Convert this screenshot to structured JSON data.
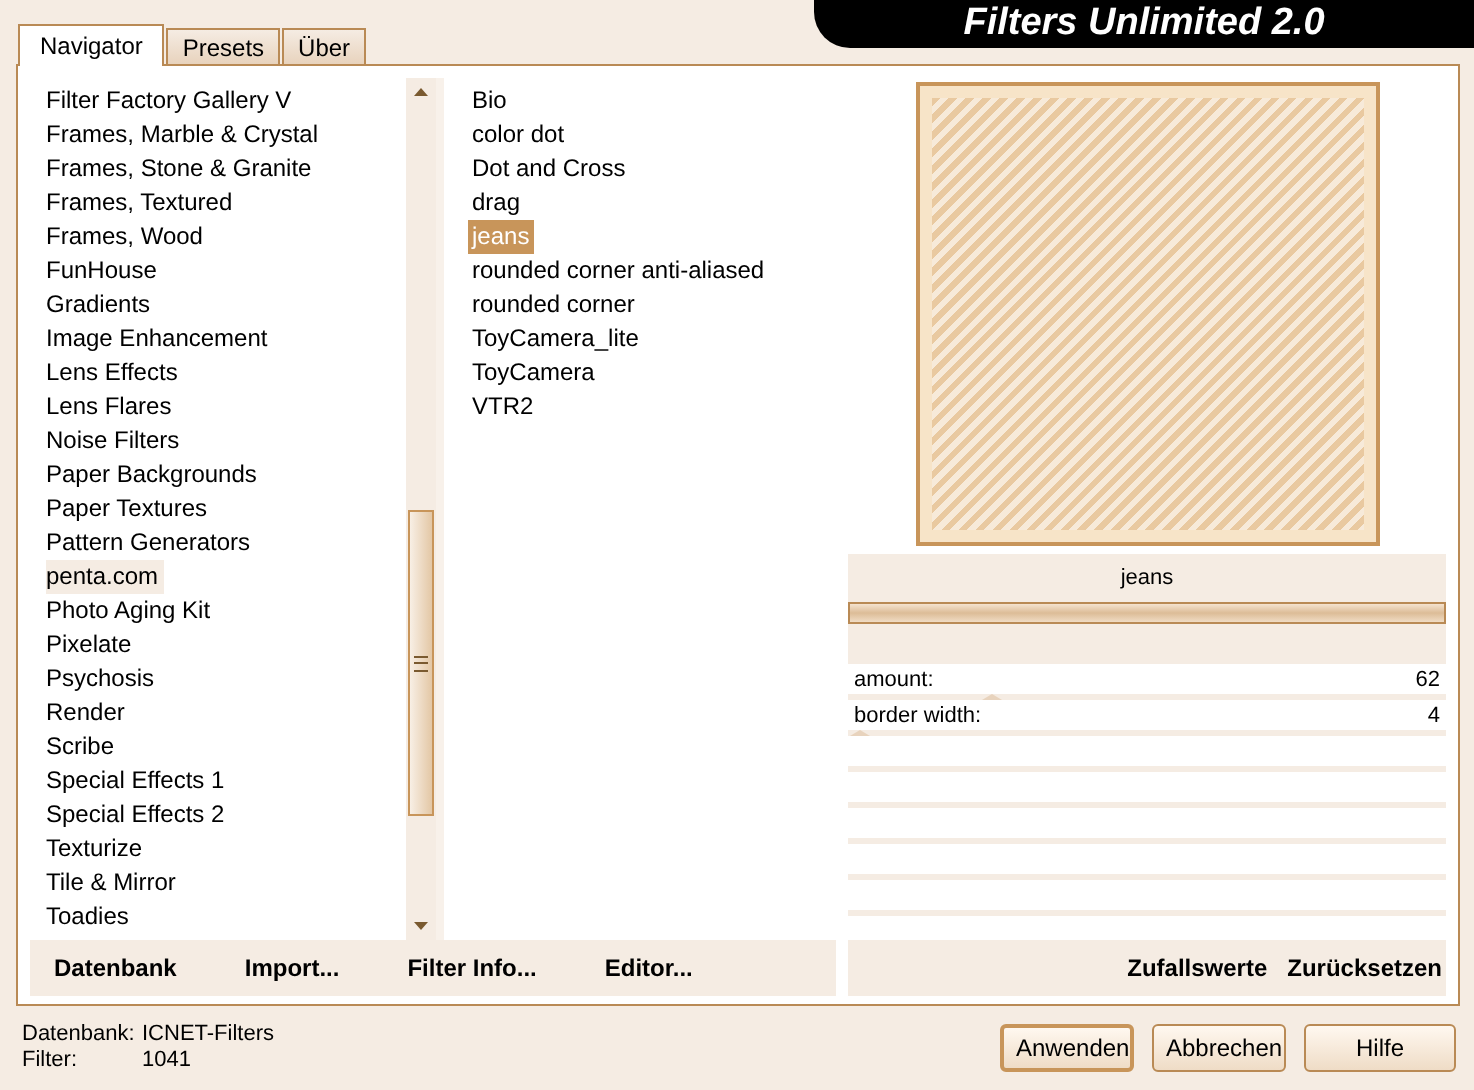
{
  "window": {
    "title": "Filters Unlimited 2.0"
  },
  "tabs": [
    {
      "label": "Navigator",
      "selected": true
    },
    {
      "label": "Presets",
      "selected": false
    },
    {
      "label": "Über",
      "selected": false
    }
  ],
  "categories": [
    {
      "label": "Filter Factory Gallery V",
      "selected": false
    },
    {
      "label": "Frames, Marble & Crystal",
      "selected": false
    },
    {
      "label": "Frames, Stone & Granite",
      "selected": false
    },
    {
      "label": "Frames, Textured",
      "selected": false
    },
    {
      "label": "Frames, Wood",
      "selected": false
    },
    {
      "label": "FunHouse",
      "selected": false
    },
    {
      "label": "Gradients",
      "selected": false
    },
    {
      "label": "Image Enhancement",
      "selected": false
    },
    {
      "label": "Lens Effects",
      "selected": false
    },
    {
      "label": "Lens Flares",
      "selected": false
    },
    {
      "label": "Noise Filters",
      "selected": false
    },
    {
      "label": "Paper Backgrounds",
      "selected": false
    },
    {
      "label": "Paper Textures",
      "selected": false
    },
    {
      "label": "Pattern Generators",
      "selected": false
    },
    {
      "label": "penta.com",
      "selected": true
    },
    {
      "label": "Photo Aging Kit",
      "selected": false
    },
    {
      "label": "Pixelate",
      "selected": false
    },
    {
      "label": "Psychosis",
      "selected": false
    },
    {
      "label": "Render",
      "selected": false
    },
    {
      "label": "Scribe",
      "selected": false
    },
    {
      "label": "Special Effects 1",
      "selected": false
    },
    {
      "label": "Special Effects 2",
      "selected": false
    },
    {
      "label": "Texturize",
      "selected": false
    },
    {
      "label": "Tile & Mirror",
      "selected": false
    },
    {
      "label": "Toadies",
      "selected": false
    }
  ],
  "filters": [
    {
      "label": "Bio",
      "selected": false
    },
    {
      "label": "color dot",
      "selected": false
    },
    {
      "label": "Dot and Cross",
      "selected": false
    },
    {
      "label": "drag",
      "selected": false
    },
    {
      "label": "jeans",
      "selected": true
    },
    {
      "label": "rounded corner anti-aliased",
      "selected": false
    },
    {
      "label": "rounded corner",
      "selected": false
    },
    {
      "label": "ToyCamera_lite",
      "selected": false
    },
    {
      "label": "ToyCamera",
      "selected": false
    },
    {
      "label": "VTR2",
      "selected": false
    }
  ],
  "left_buttons": [
    "Datenbank",
    "Import...",
    "Filter Info...",
    "Editor..."
  ],
  "preview": {
    "filter_name": "jeans",
    "level": 1
  },
  "parameters": [
    {
      "label": "amount:",
      "value": "62",
      "level": 0.24
    },
    {
      "label": "border width:",
      "value": "4",
      "level": 0.02
    }
  ],
  "right_buttons": [
    "Zufallswerte",
    "Zurücksetzen"
  ],
  "status": [
    {
      "label": "Datenbank:",
      "value": "ICNET-Filters"
    },
    {
      "label": "Filter:",
      "value": "1041"
    }
  ],
  "dialog_buttons": [
    "Anwenden",
    "Abbrechen",
    "Hilfe"
  ]
}
